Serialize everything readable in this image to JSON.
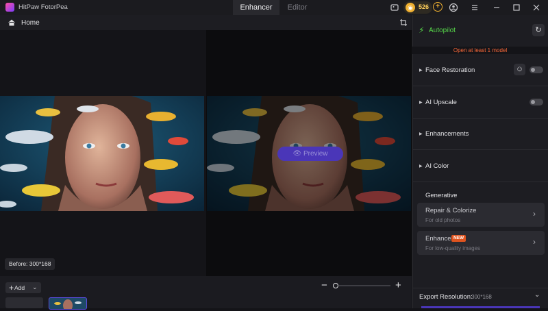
{
  "app": {
    "title": "HitPaw FotorPea"
  },
  "tabs": [
    {
      "label": "Enhancer"
    },
    {
      "label": "Editor"
    }
  ],
  "titlebar": {
    "credits": "526",
    "icons": [
      "gallery-icon",
      "coin-icon",
      "add-credits-icon",
      "account-icon",
      "menu-icon",
      "minimize-icon",
      "maximize-icon",
      "close-icon"
    ]
  },
  "toolbar": {
    "home_label": "Home",
    "icons": [
      "home-icon",
      "crop-icon"
    ]
  },
  "canvas": {
    "preview_label": "Preview",
    "before_tag": "Before: 300*168"
  },
  "bottom": {
    "add_label": "Add",
    "zoom_minus": "−",
    "zoom_plus": "+",
    "zoom_level": 0.0
  },
  "panel": {
    "autopilot_label": "Autopilot",
    "warning": "Open at least 1 model",
    "sections": [
      {
        "label": "Face Restoration"
      },
      {
        "label": "AI Upscale"
      },
      {
        "label": "Enhancements"
      },
      {
        "label": "AI Color"
      }
    ],
    "generative_label": "Generative",
    "cards": [
      {
        "title": "Repair & Colorize",
        "subtitle": "For old photos"
      },
      {
        "title": "Enhancer",
        "badge": "NEW",
        "subtitle": "For low-quality images"
      }
    ],
    "export_label": "Export Resolution:",
    "export_value": "300*168"
  },
  "colors": {
    "accent": "#4a36b8",
    "autopilot": "#57d94a",
    "warning": "#ff6a3a",
    "badge": "#e0541f"
  }
}
